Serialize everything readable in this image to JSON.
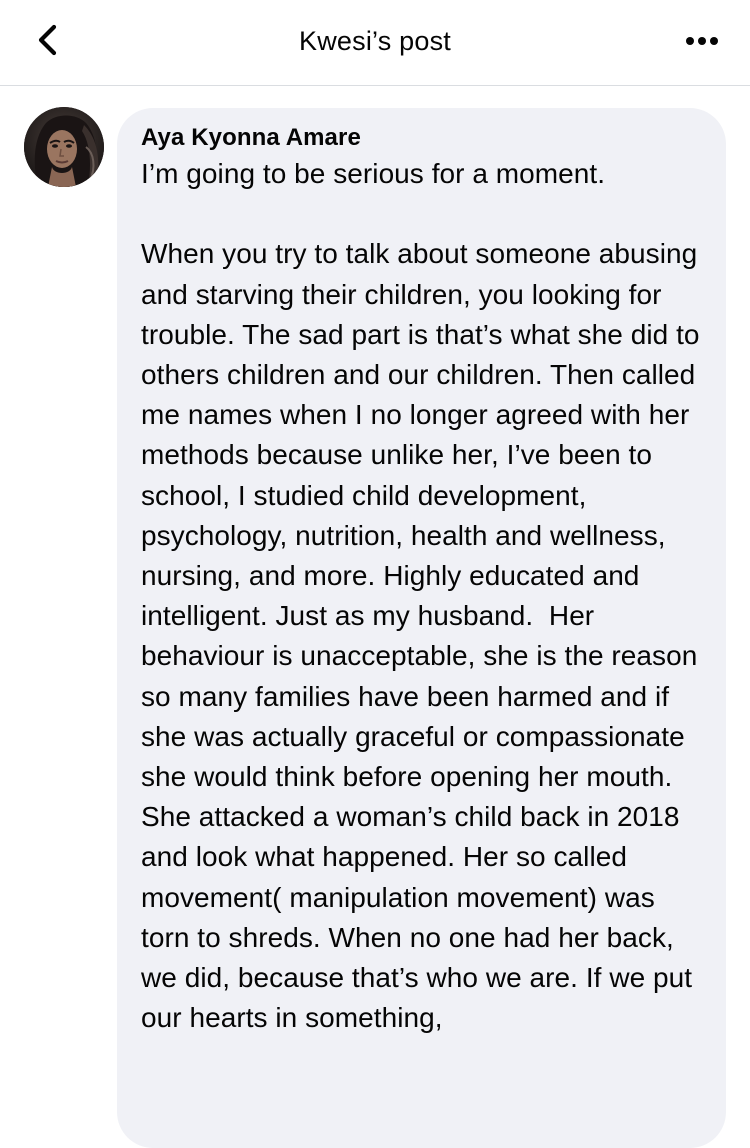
{
  "header": {
    "title": "Kwesi’s post",
    "back_icon": "chevron-left-icon",
    "more_icon": "ellipsis-icon"
  },
  "comment": {
    "author": "Aya Kyonna Amare",
    "avatar_icon": "profile-photo",
    "text": "I’m going to be serious for a moment.\n\nWhen you try to talk about someone abusing and starving their children, you looking for trouble. The sad part is that’s what she did to others children and our children. Then called me names when I no longer agreed with her methods because unlike her, I’ve been to school, I studied child development, psychology, nutrition, health and wellness, nursing, and more. Highly educated and intelligent. Just as my husband.  Her behaviour is unacceptable, she is the reason so many families have been harmed and if she was actually graceful or compassionate she would think before opening her mouth. She attacked a woman’s child back in 2018 and look what happened. Her so called movement( manipulation movement) was torn to shreds. When no one had her back, we did, because that’s who we are. If we put our hearts in something,"
  },
  "colors": {
    "bubble_background": "#f0f1f6",
    "text": "#050505",
    "divider": "#dadde1"
  }
}
